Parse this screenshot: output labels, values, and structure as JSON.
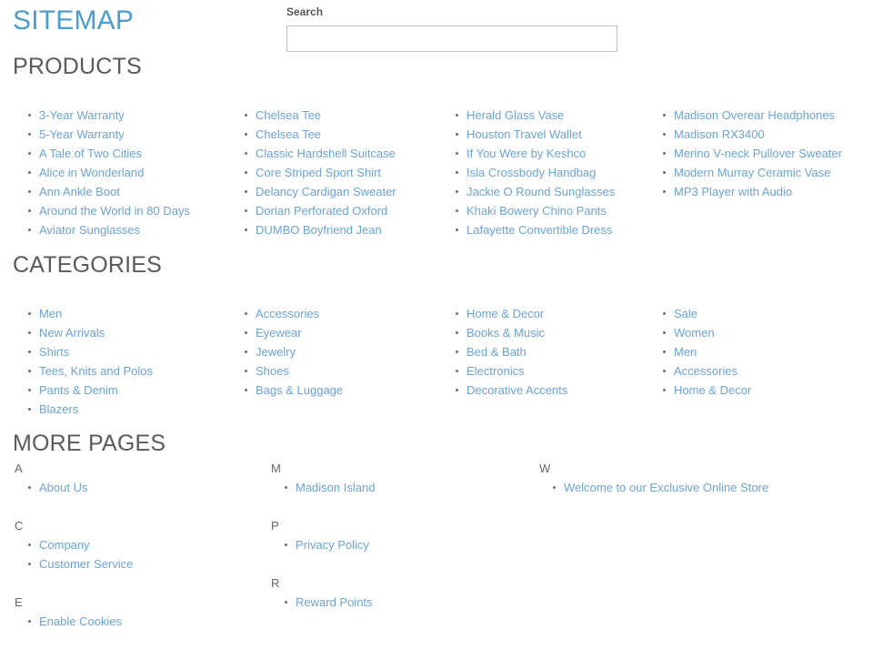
{
  "page": {
    "title": "SITEMAP",
    "link_color": "#6ba3d6",
    "title_color": "#4d9ccc",
    "heading_color": "#5a5a5a"
  },
  "search": {
    "label": "Search",
    "value": "",
    "placeholder": ""
  },
  "sections": {
    "products": {
      "heading": "PRODUCTS",
      "columns": [
        [
          "3-Year Warranty",
          "5-Year Warranty",
          "A Tale of Two Cities",
          "Alice in Wonderland",
          "Ann Ankle Boot",
          "Around the World in 80 Days",
          "Aviator Sunglasses"
        ],
        [
          "Chelsea Tee",
          "Chelsea Tee",
          "Classic Hardshell Suitcase",
          "Core Striped Sport Shirt",
          "Delancy Cardigan Sweater",
          "Dorian Perforated Oxford",
          "DUMBO Boyfriend Jean"
        ],
        [
          "Herald Glass Vase",
          "Houston Travel Wallet",
          "If You Were by Keshco",
          "Isla Crossbody Handbag",
          "Jackie O Round Sunglasses",
          "Khaki Bowery Chino Pants",
          "Lafayette Convertible Dress"
        ],
        [
          "Madison Overear Headphones",
          "Madison RX3400",
          "Merino V-neck Pullover Sweater",
          "Modern Murray Ceramic Vase",
          "MP3 Player with Audio"
        ]
      ]
    },
    "categories": {
      "heading": "CATEGORIES",
      "columns": [
        [
          "Men",
          "New Arrivals",
          "Shirts",
          "Tees, Knits and Polos",
          "Pants & Denim",
          "Blazers"
        ],
        [
          "Accessories",
          "Eyewear",
          "Jewelry",
          "Shoes",
          "Bags & Luggage"
        ],
        [
          "Home & Decor",
          "Books & Music",
          "Bed & Bath",
          "Electronics",
          "Decorative Accents"
        ],
        [
          "Sale",
          "Women",
          "Men",
          "Accessories",
          "Home & Decor"
        ]
      ]
    },
    "more_pages": {
      "heading": "MORE PAGES",
      "columns": [
        [
          {
            "letter": "A",
            "items": [
              "About Us"
            ]
          },
          {
            "letter": "C",
            "items": [
              "Company",
              "Customer Service"
            ]
          },
          {
            "letter": "E",
            "items": [
              "Enable Cookies"
            ]
          }
        ],
        [
          {
            "letter": "M",
            "items": [
              "Madison Island"
            ]
          },
          {
            "letter": "P",
            "items": [
              "Privacy Policy"
            ]
          },
          {
            "letter": "R",
            "items": [
              "Reward Points"
            ]
          }
        ],
        [
          {
            "letter": "W",
            "items": [
              "Welcome to our Exclusive Online Store"
            ]
          }
        ]
      ]
    }
  }
}
